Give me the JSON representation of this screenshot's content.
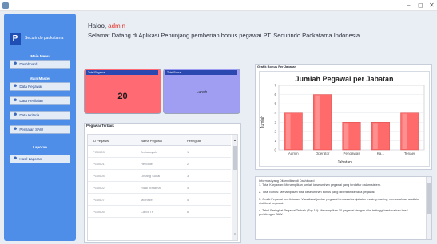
{
  "window": {
    "minimize_glyph": "–",
    "maximize_glyph": "◻",
    "close_glyph": "✕"
  },
  "sidebar": {
    "logo_letter": "P",
    "logo_text": "Securindo packatama",
    "main_menu_title": "Main Menu",
    "dashboard_label": "Dashboard",
    "master_title": "Main Master",
    "master_items": [
      "Data Pegawai",
      "Data Penilaian",
      "Data Kriteria",
      "Penilaian SAW"
    ],
    "report_title": "Laporan",
    "report_items": [
      "Hasil Laporan"
    ]
  },
  "header": {
    "greeting": "Haloo,",
    "username": "admin",
    "welcome": "Selamat Datang di Aplikasi Penunjang pemberian bonus pegawai PT. Securindo Packatama Indonesia"
  },
  "cards": {
    "total_pegawai_title": "Total Pegawai",
    "total_pegawai_value": "20",
    "total_bonus_title": "Total Bonus",
    "total_bonus_value": "Lunch"
  },
  "table": {
    "title": "Pegawai Terbaik",
    "columns": [
      "ID Pegawai",
      "Nama Pegawai",
      "Peringkat"
    ],
    "rows": [
      [
        "PG0003",
        "Ardiansyah",
        "1"
      ],
      [
        "PG0001",
        "Hendhie",
        "2"
      ],
      [
        "PG0004",
        "Lintang Sukai",
        "3"
      ],
      [
        "PG0002",
        "Rizal pratama",
        "4"
      ],
      [
        "PG0007",
        "Michelle",
        "5"
      ],
      [
        "PG0005",
        "Candi Tri",
        "6"
      ]
    ]
  },
  "chart_panel": {
    "caption": "Grafik Bonus Per Jabatan"
  },
  "chart_data": {
    "type": "bar",
    "title": "Jumlah Pegawai per Jabatan",
    "xlabel": "Jabatan",
    "ylabel": "Jumlah",
    "categories": [
      "Admin",
      "Operator",
      "Pengawas",
      "Ka...",
      "Tenaer"
    ],
    "values": [
      4,
      6,
      3,
      3,
      4
    ],
    "ylim": [
      0,
      7
    ],
    "yticks": [
      0,
      1,
      2,
      3,
      4,
      5,
      6,
      7
    ],
    "grid": true,
    "bar_color": "#ff6b6b"
  },
  "info": {
    "title": "Informasi yang Ditampilkan di Dashboard",
    "lines": [
      "1. Total Karyawan: Menampilkan jumlah keseluruhan pegawai yang terdaftar dalam sistem.",
      "2. Total Bonus: Menampilkan total keseluruhan bonus yang diberikan kepada pegawai.",
      "3. Grafik Pegawai per Jabatan: Visualisasi jumlah pegawai berdasarkan jabatan masing-masing, memudahkan analisis distribusi pegawai.",
      "4. Tabel Peringkat Pegawai Terbaik (Top 10): Menampilkan 10 pegawai dengan nilai tertinggi berdasarkan hasil perhitungan SAW."
    ]
  }
}
